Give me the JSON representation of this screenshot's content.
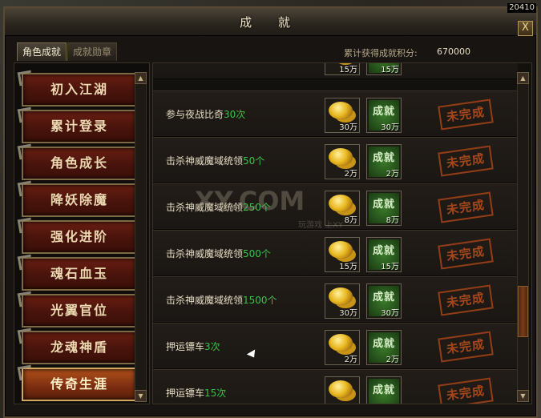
{
  "window": {
    "title": "成 就",
    "close_label": "X",
    "clock": "20410"
  },
  "tabs": [
    {
      "label": "角色成就",
      "active": true
    },
    {
      "label": "成就勋章",
      "active": false
    }
  ],
  "score": {
    "label": "累计获得成就积分:",
    "value": "670000"
  },
  "categories": [
    "初入江湖",
    "累计登录",
    "角色成长",
    "降妖除魔",
    "强化进阶",
    "魂石血玉",
    "光翼官位",
    "龙魂神盾",
    "传奇生涯"
  ],
  "selected_category": "传奇生涯",
  "reward_badge_label": "成就",
  "achievements": [
    {
      "label": "",
      "count": "",
      "coin": "15万",
      "points": "15万",
      "status": ""
    },
    {
      "label": "参与夜战比奇",
      "count": "30次",
      "coin": "30万",
      "points": "30万",
      "status": "未完成"
    },
    {
      "label": "击杀神威魔域统领",
      "count": "50个",
      "coin": "2万",
      "points": "2万",
      "status": "未完成"
    },
    {
      "label": "击杀神威魔域统领",
      "count": "250个",
      "coin": "8万",
      "points": "8万",
      "status": "未完成"
    },
    {
      "label": "击杀神威魔域统领",
      "count": "500个",
      "coin": "15万",
      "points": "15万",
      "status": "未完成"
    },
    {
      "label": "击杀神威魔域统领",
      "count": "1500个",
      "coin": "30万",
      "points": "30万",
      "status": "未完成"
    },
    {
      "label": "押运镖车",
      "count": "3次",
      "coin": "2万",
      "points": "2万",
      "status": "未完成"
    },
    {
      "label": "押运镖车",
      "count": "15次",
      "coin": "",
      "points": "",
      "status": "未完成"
    }
  ],
  "watermark": {
    "text": "XY.COM",
    "sub": "玩游戏 上XY"
  },
  "scroll_arrows": {
    "up": "▲",
    "down": "▼"
  }
}
